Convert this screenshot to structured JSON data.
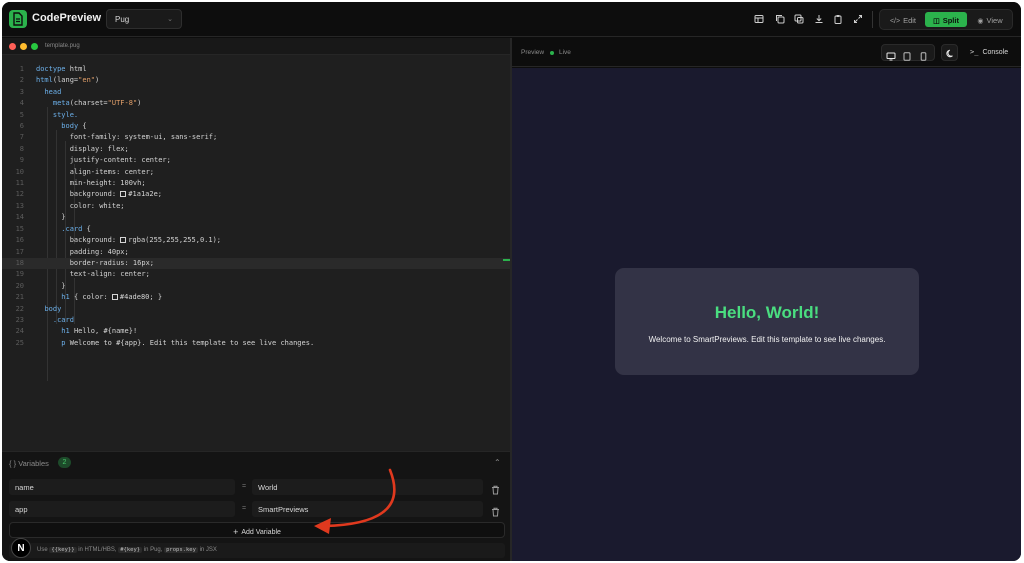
{
  "app": {
    "brand": "CodePreview",
    "language": "Pug",
    "modes": [
      {
        "label": "Edit",
        "icon": "code-icon"
      },
      {
        "label": "Split",
        "icon": "split-icon",
        "active": true
      },
      {
        "label": "View",
        "icon": "eye-icon"
      }
    ],
    "toolbar_icons": [
      "templates-icon",
      "copy-icon",
      "duplicate-icon",
      "download-icon",
      "clipboard-icon",
      "expand-icon"
    ]
  },
  "editor": {
    "file_name": "template.pug",
    "highlighted_line": 18,
    "lines": [
      {
        "n": "1",
        "code": "doctype html"
      },
      {
        "n": "2",
        "code": "html(lang=\"en\")"
      },
      {
        "n": "3",
        "code": "  head"
      },
      {
        "n": "4",
        "code": "    meta(charset=\"UTF-8\")"
      },
      {
        "n": "5",
        "code": "    style."
      },
      {
        "n": "6",
        "code": "      body {"
      },
      {
        "n": "7",
        "code": "        font-family: system-ui, sans-serif;"
      },
      {
        "n": "8",
        "code": "        display: flex;"
      },
      {
        "n": "9",
        "code": "        justify-content: center;"
      },
      {
        "n": "10",
        "code": "        align-items: center;"
      },
      {
        "n": "11",
        "code": "        min-height: 100vh;"
      },
      {
        "n": "12",
        "code": "        background: #1a1a2e;"
      },
      {
        "n": "13",
        "code": "        color: white;"
      },
      {
        "n": "14",
        "code": "      }"
      },
      {
        "n": "15",
        "code": "      .card {"
      },
      {
        "n": "16",
        "code": "        background: rgba(255,255,255,0.1);"
      },
      {
        "n": "17",
        "code": "        padding: 40px;"
      },
      {
        "n": "18",
        "code": "        border-radius: 16px;"
      },
      {
        "n": "19",
        "code": "        text-align: center;"
      },
      {
        "n": "20",
        "code": "      }"
      },
      {
        "n": "21",
        "code": "      h1 { color: #4ade80; }"
      },
      {
        "n": "22",
        "code": "  body"
      },
      {
        "n": "23",
        "code": "    .card"
      },
      {
        "n": "24",
        "code": "      h1 Hello, #{name}!"
      },
      {
        "n": "25",
        "code": "      p Welcome to #{app}. Edit this template to see live changes."
      }
    ]
  },
  "variables": {
    "title": "Variables",
    "count": "2",
    "items": [
      {
        "key": "name",
        "value": "World"
      },
      {
        "key": "app",
        "value": "SmartPreviews"
      }
    ],
    "add_label": "Add Variable",
    "hint": {
      "p1": "Use ",
      "c1": "{{key}}",
      "p2": " in HTML/HBS, ",
      "c2": "#{key}",
      "p3": " in Pug, ",
      "c3": "props.key",
      "p4": " in JSX"
    }
  },
  "preview": {
    "label": "Preview",
    "status": "Live",
    "console_label": "Console",
    "card_title": "Hello, World!",
    "card_text": "Welcome to SmartPreviews. Edit this template to see live changes."
  },
  "colors": {
    "accent": "#2bb24c",
    "preview_bg": "#1a1a2e",
    "heading": "#4ade80",
    "annotation": "#e0391e"
  }
}
